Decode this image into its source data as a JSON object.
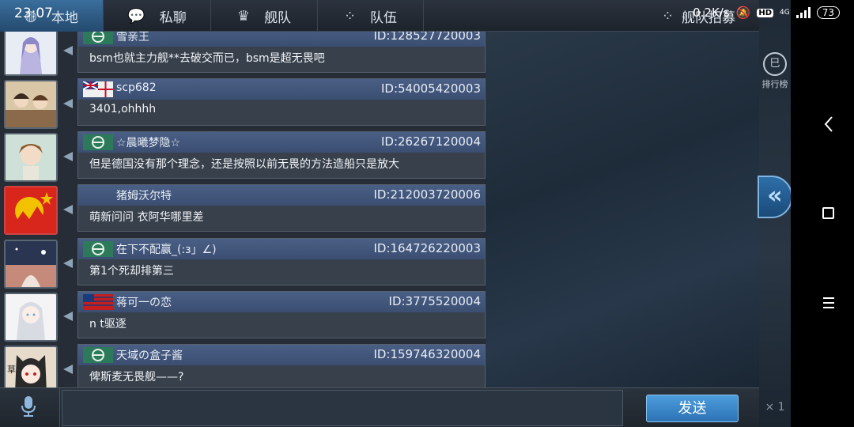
{
  "status_bar": {
    "time": "23:07",
    "net_speed": "0.2K/s",
    "hd_label": "HD",
    "network_type": "4G",
    "battery": "73"
  },
  "tabs": [
    {
      "label": "本地",
      "icon": "globe-icon",
      "active": true
    },
    {
      "label": "私聊",
      "icon": "chat-bubble-icon",
      "active": false
    },
    {
      "label": "舰队",
      "icon": "fleet-emblem-icon",
      "active": false
    },
    {
      "label": "队伍",
      "icon": "team-icon",
      "active": false
    },
    {
      "label": "舰队招募",
      "icon": "recruit-icon",
      "active": false
    }
  ],
  "side_panel": {
    "rank_label": "排行榜",
    "collapse_icon": "double-chevron-left-icon",
    "badge_text": "× 1"
  },
  "messages": [
    {
      "name": "雪亲王",
      "uid": "ID:128527720003",
      "text": "bsm也就主力舰**去破交而已，bsm是超无畏吧",
      "badge": "green"
    },
    {
      "name": "scp682",
      "uid": "ID:54005420003",
      "text": "3401,ohhhh",
      "badge": "uk"
    },
    {
      "name": "☆晨曦梦隐☆",
      "uid": "ID:26267120004",
      "text": "但是德国没有那个理念，还是按照以前无畏的方法造船只是放大",
      "badge": "green"
    },
    {
      "name": "猪姆沃尔特",
      "uid": "ID:212003720006",
      "text": "萌新问问  衣阿华哪里差",
      "badge": "none"
    },
    {
      "name": "在下不配赢_(:з」∠)",
      "uid": "ID:164726220003",
      "text": "第1个死却排第三",
      "badge": "green"
    },
    {
      "name": "蒋可一の恋",
      "uid": "ID:3775520004",
      "text": "n t驱逐",
      "badge": "red"
    },
    {
      "name": "天域の盒子酱",
      "uid": "ID:159746320004",
      "text": "俾斯麦无畏舰——?",
      "badge": "green"
    }
  ],
  "input": {
    "value": "",
    "placeholder": "",
    "send_label": "发送"
  },
  "colors": {
    "header_gradient": "#4a5f85",
    "send_button": "#3d8bd0",
    "active_tab": "#3a6e9c"
  }
}
